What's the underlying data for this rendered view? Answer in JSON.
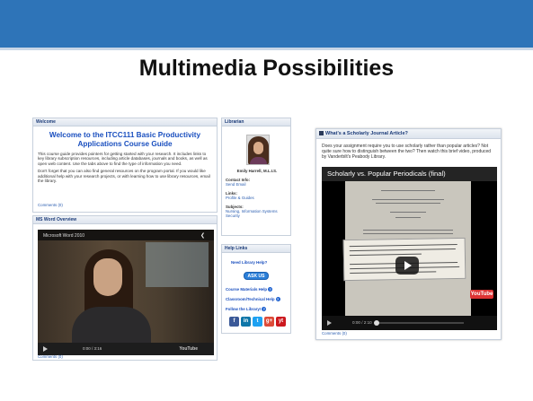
{
  "slide": {
    "title": "Multimedia Possibilities"
  },
  "welcome": {
    "header": "Welcome",
    "title": "Welcome to the ITCC111 Basic Productivity Applications Course Guide",
    "para1": "This course guide provides pointers for getting started with your research. It includes links to key library subscription resources, including article databases, journals and books, as well as open web content. Use the tabs above to find the type of information you need.",
    "para2": "Don't forget that you can also find general resources on the program portal. If you would like additional help with your research projects, or with learning how to use library resources, email the library.",
    "comments": "Comments (0)"
  },
  "word": {
    "header": "MS Word Overview",
    "video_title": "Microsoft Word 2010",
    "time": "0:00 / 3:16",
    "brand": "YouTube",
    "comments": "Comments (0)"
  },
  "librarian": {
    "header": "Librarian",
    "name": "Emily Harrell, M.L.I.S.",
    "contact_label": "Contact Info:",
    "contact_link": "Send Email",
    "links_label": "Links:",
    "links_link": "Profile & Guides",
    "subjects_label": "Subjects:",
    "subjects_link": "Nursing, Information Systems Security"
  },
  "help": {
    "header": "Help Links",
    "need_help": "Need Library Help?",
    "ask_button": "ASK US",
    "course_help": "Course Materials Help",
    "classroom_help": "Classroom/Technical Help",
    "follow": "Follow the Library!",
    "social": [
      "f",
      "in",
      "t",
      "g+",
      "yt"
    ]
  },
  "scholar": {
    "header": "What's a Scholarly Journal Article?",
    "description": "Does your assignment require you to use scholarly rather than popular articles? Not quite sure how to distinguish between the two? Then watch this brief video, produced by Vanderbilt's Peabody Library.",
    "video_title": "Scholarly vs. Popular Periodicals (final)",
    "time": "0:00 / 2:10",
    "brand": "YouTube",
    "comments": "Comments (0)"
  },
  "colors": {
    "top_bar": "#2e74b8",
    "link": "#2a5db0",
    "title_blue": "#1a4fbf"
  }
}
